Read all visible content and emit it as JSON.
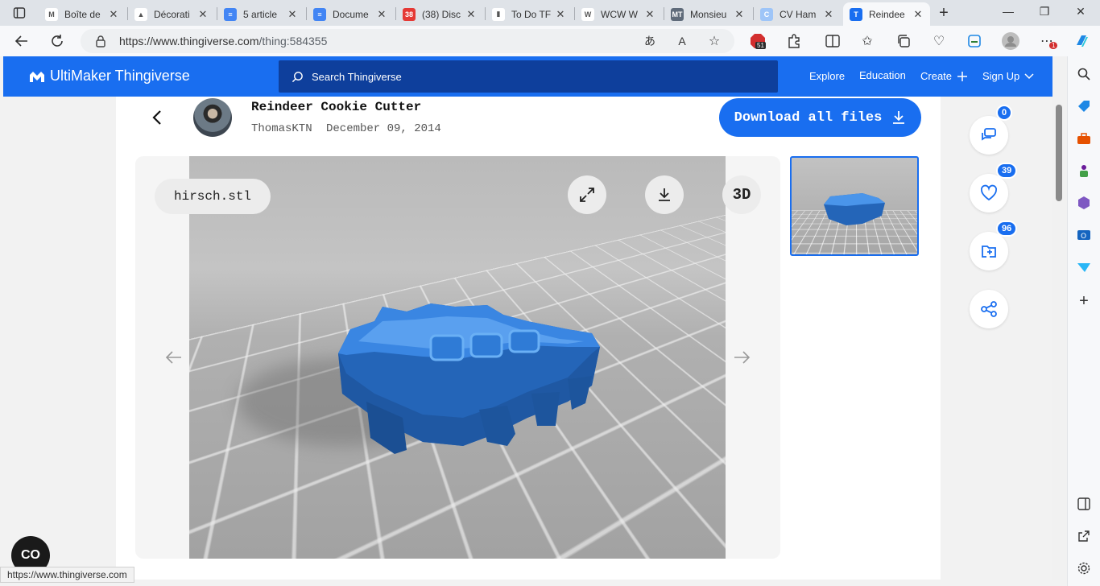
{
  "browser": {
    "tabs": [
      {
        "label": "Boîte de",
        "fav_color": "#ffffff",
        "fav_text": "M"
      },
      {
        "label": "Décorati",
        "fav_color": "#ffffff",
        "fav_text": "▲"
      },
      {
        "label": "5 article",
        "fav_color": "#4285f4",
        "fav_text": "≡"
      },
      {
        "label": "Docume",
        "fav_color": "#4285f4",
        "fav_text": "≡"
      },
      {
        "label": "(38) Disc",
        "fav_color": "#e53935",
        "fav_text": "38"
      },
      {
        "label": "To Do TF",
        "fav_color": "#ffffff",
        "fav_text": "▮"
      },
      {
        "label": "WCW W",
        "fav_color": "#ffffff",
        "fav_text": "W"
      },
      {
        "label": "Monsieu",
        "fav_color": "#5f6b7a",
        "fav_text": "MT"
      },
      {
        "label": "CV Ham",
        "fav_color": "#9ec5f8",
        "fav_text": "C"
      },
      {
        "label": "Reindee",
        "fav_color": "#196ef0",
        "fav_text": "T"
      }
    ],
    "url_host": "https://www.thingiverse.com",
    "url_path": "/thing:584355",
    "ext_badge": "51",
    "notif_badge": "1",
    "status_url": "https://www.thingiverse.com"
  },
  "site": {
    "logo_text": "UltiMaker Thingiverse",
    "search_placeholder": "Search Thingiverse",
    "nav": {
      "explore": "Explore",
      "education": "Education",
      "create": "Create",
      "signup": "Sign Up"
    },
    "brand_color": "#196ef0"
  },
  "thing": {
    "title": "Reindeer Cookie Cutter",
    "author": "ThomasKTN",
    "date": "December 09, 2014",
    "download_label": "Download all files",
    "filename": "hirsch.stl",
    "viewer_3d_label": "3D",
    "model_color": "#2f7bd6"
  },
  "actions": {
    "comments": "0",
    "likes": "39",
    "collections": "96"
  },
  "cookie_label": "CO"
}
